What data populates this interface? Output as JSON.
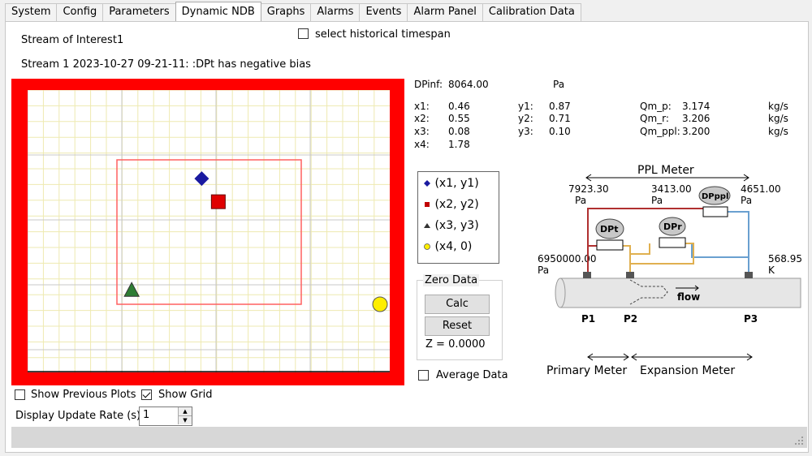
{
  "tabs": [
    "System",
    "Config",
    "Parameters",
    "Dynamic NDB",
    "Graphs",
    "Alarms",
    "Events",
    "Alarm Panel",
    "Calibration Data"
  ],
  "active_tab_index": 3,
  "stream_of_interest": {
    "label": "Stream of Interest",
    "value": "1"
  },
  "historical_checkbox": {
    "label": "select historical timespan",
    "checked": false
  },
  "status_message": "Stream 1 2023-10-27 09-21-11:  :DPt has negative bias",
  "readouts": {
    "dpinf_label": "DPinf:",
    "dpinf_value": "8064.00",
    "dpinf_unit": "Pa",
    "x1_label": "x1:",
    "x1": "0.46",
    "x2_label": "x2:",
    "x2": "0.55",
    "x3_label": "x3:",
    "x3": "0.08",
    "x4_label": "x4:",
    "x4": "1.78",
    "y1_label": "y1:",
    "y1": "0.87",
    "y2_label": "y2:",
    "y2": "0.71",
    "y3_label": "y3:",
    "y3": "0.10",
    "qm_p_label": "Qm_p:",
    "qm_p": "3.174",
    "qm_r_label": "Qm_r:",
    "qm_r": "3.206",
    "qm_ppl_label": "Qm_ppl:",
    "qm_ppl": "3.200",
    "qm_unit": "kg/s"
  },
  "legend": [
    "(x1, y1)",
    "(x2, y2)",
    "(x3, y3)",
    "(x4, 0)"
  ],
  "colors": {
    "x1": "#1a1aa0",
    "x2": "#e00000",
    "x3": "#2e7d32",
    "x4": "#ffee00",
    "frame": "#ff0000",
    "grid_minor": "#eeeab0",
    "grid_major": "#c8c8c8"
  },
  "zero_data": {
    "title": "Zero Data",
    "calc_label": "Calc",
    "reset_label": "Reset",
    "z_text": "Z =  0.0000"
  },
  "average_data": {
    "label": "Average Data",
    "checked": false
  },
  "show_previous_plots": {
    "label": "Show Previous Plots",
    "checked": false
  },
  "show_grid": {
    "label": "Show Grid",
    "checked": true
  },
  "display_update_rate": {
    "label": "Display Update Rate (s)",
    "value": "1"
  },
  "diagram": {
    "ppl_meter": "PPL Meter",
    "p_left": "7923.30",
    "p_mid": "3413.00",
    "p_right": "4651.00",
    "pa": "Pa",
    "p_inlet": "6950000.00",
    "temp": "568.95",
    "temp_unit": "K",
    "dpt": "DPt",
    "dpr": "DPr",
    "dpppl": "DPppl",
    "flow": "flow",
    "p1": "P1",
    "p2": "P2",
    "p3": "P3",
    "primary_meter": "Primary Meter",
    "expansion_meter": "Expansion Meter"
  },
  "chart_data": {
    "type": "scatter",
    "points": [
      {
        "series": "(x1, y1)",
        "x": 0.46,
        "y": 0.87,
        "marker": "diamond"
      },
      {
        "series": "(x2, y2)",
        "x": 0.55,
        "y": 0.71,
        "marker": "square"
      },
      {
        "series": "(x3, y3)",
        "x": 0.08,
        "y": 0.1,
        "marker": "triangle"
      },
      {
        "series": "(x4, 0)",
        "x": 1.78,
        "y": 0,
        "marker": "circle"
      }
    ],
    "grid": true
  }
}
